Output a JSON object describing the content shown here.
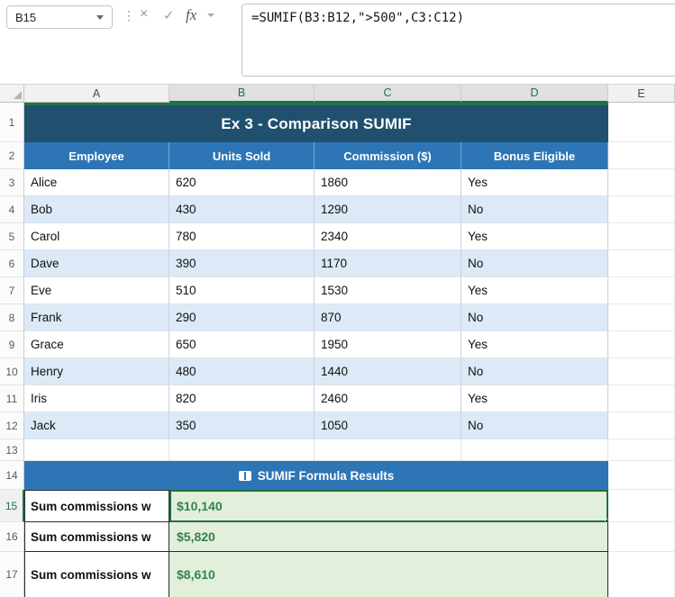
{
  "formula_bar": {
    "name_box": "B15",
    "formula": "=SUMIF(B3:B12,\">500\",C3:C12)"
  },
  "icons": {
    "vertical_dots": "⋮",
    "cancel": "×",
    "enter": "✓",
    "fx": "fx"
  },
  "sheet": {
    "columns": [
      "A",
      "B",
      "C",
      "D",
      "E"
    ],
    "row_numbers": [
      "1",
      "2",
      "3",
      "4",
      "5",
      "6",
      "7",
      "8",
      "9",
      "10",
      "11",
      "12",
      "13",
      "14",
      "15",
      "16",
      "17"
    ],
    "title": "Ex 3 - Comparison SUMIF",
    "table": {
      "headers": [
        "Employee",
        "Units Sold",
        "Commission ($)",
        "Bonus Eligible"
      ],
      "rows": [
        [
          "Alice",
          "620",
          "1860",
          "Yes"
        ],
        [
          "Bob",
          "430",
          "1290",
          "No"
        ],
        [
          "Carol",
          "780",
          "2340",
          "Yes"
        ],
        [
          "Dave",
          "390",
          "1170",
          "No"
        ],
        [
          "Eve",
          "510",
          "1530",
          "Yes"
        ],
        [
          "Frank",
          "290",
          "870",
          "No"
        ],
        [
          "Grace",
          "650",
          "1950",
          "Yes"
        ],
        [
          "Henry",
          "480",
          "1440",
          "No"
        ],
        [
          "Iris",
          "820",
          "2460",
          "Yes"
        ],
        [
          "Jack",
          "350",
          "1050",
          "No"
        ]
      ]
    },
    "results": {
      "banner": "SUMIF Formula Results",
      "items": [
        {
          "label": "Sum commissions w",
          "value": "$10,140"
        },
        {
          "label": "Sum commissions w",
          "value": "$5,820"
        },
        {
          "label": "Sum commissions w",
          "value": "$8,610"
        }
      ]
    }
  },
  "colors": {
    "title_bar": "#20506E",
    "table_header": "#2E75B6",
    "band_row": "#DCE9F7",
    "results_banner": "#2E75B6",
    "result_fill": "#E2EFDA",
    "result_text": "#35824C",
    "selection_green": "#1E7145"
  }
}
